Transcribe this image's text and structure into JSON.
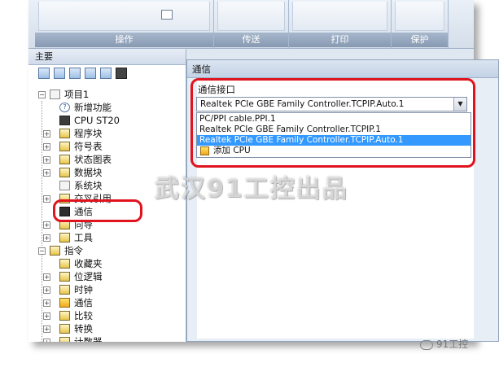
{
  "ribbon": {
    "groups": [
      {
        "label": "操作"
      },
      {
        "label": "传送"
      },
      {
        "label": "打印"
      },
      {
        "label": "保护"
      }
    ]
  },
  "tree": {
    "header": "主要",
    "items": [
      {
        "label": "项目1"
      },
      {
        "label": "新增功能"
      },
      {
        "label": "CPU ST20"
      },
      {
        "label": "程序块"
      },
      {
        "label": "符号表"
      },
      {
        "label": "状态图表"
      },
      {
        "label": "数据块"
      },
      {
        "label": "系统块"
      },
      {
        "label": "交叉引用"
      },
      {
        "label": "通信"
      },
      {
        "label": "向导"
      },
      {
        "label": "工具"
      },
      {
        "label": "指令"
      },
      {
        "label": "收藏夹"
      },
      {
        "label": "位逻辑"
      },
      {
        "label": "时钟"
      },
      {
        "label": "通信"
      },
      {
        "label": "比较"
      },
      {
        "label": "转换"
      },
      {
        "label": "计数器"
      }
    ]
  },
  "dialog": {
    "title": "通信",
    "interface_label": "通信接口",
    "selected_value": "Realtek PCIe GBE Family Controller.TCPIP.Auto.1",
    "options": [
      {
        "label": "PC/PPI cable.PPI.1"
      },
      {
        "label": "Realtek PCIe GBE Family Controller.TCPIP.1"
      },
      {
        "label": "Realtek PCIe GBE Family Controller.TCPIP.Auto.1"
      },
      {
        "label": "添加 CPU"
      }
    ]
  },
  "watermark": "武汉91工控出品",
  "wechat_badge": "91工控",
  "colors": {
    "highlight": "#e0141e",
    "selection": "#3399ff",
    "ribbon_label": "#8799b2"
  }
}
